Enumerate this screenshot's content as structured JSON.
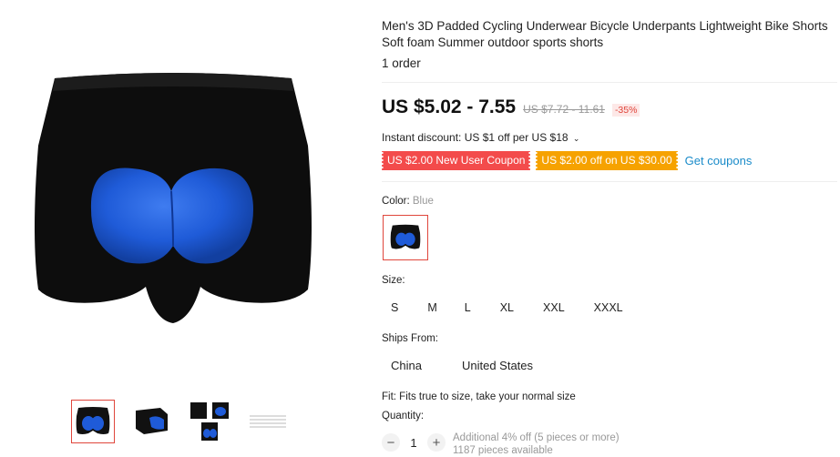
{
  "product": {
    "title": "Men's 3D Padded Cycling Underwear Bicycle Underpants Lightweight Bike Shorts Soft foam Summer outdoor sports shorts",
    "orders": "1 order"
  },
  "price": {
    "current": "US $5.02 - 7.55",
    "original": "US $7.72 - 11.61",
    "discount": "-35%"
  },
  "instant_discount": "Instant discount: US $1 off per US $18",
  "coupons": {
    "new_user": "US $2.00 New User Coupon",
    "store": "US $2.00 off on US $30.00",
    "get_label": "Get coupons"
  },
  "color": {
    "label": "Color:",
    "selected": "Blue"
  },
  "size": {
    "label": "Size:",
    "options": [
      "S",
      "M",
      "L",
      "XL",
      "XXL",
      "XXXL"
    ]
  },
  "ships_from": {
    "label": "Ships From:",
    "options": [
      "China",
      "United States"
    ]
  },
  "fit": "Fit: Fits true to size, take your normal size",
  "quantity": {
    "label": "Quantity:",
    "value": "1",
    "minus": "−",
    "plus": "+",
    "note_line1": "Additional 4% off (5 pieces or more)",
    "note_line2": "1187 pieces available"
  },
  "icons": {
    "chevron": "chevron-down-icon"
  },
  "colors": {
    "accent_red": "#e0463c",
    "coupon_red": "#f34b4b",
    "coupon_orange": "#f6a200",
    "link_blue": "#1a8bc9",
    "pad_blue": "#1f5bd8"
  }
}
